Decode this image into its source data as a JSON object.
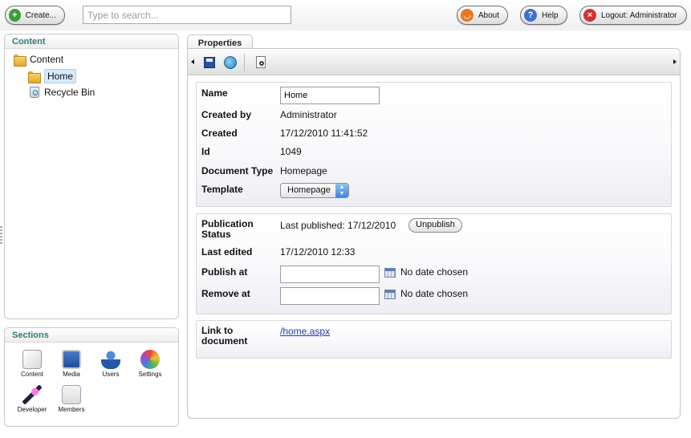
{
  "topbar": {
    "create_label": "Create...",
    "search_placeholder": "Type to search...",
    "about_label": "About",
    "help_label": "Help",
    "logout_label": "Logout: Administrator"
  },
  "content_panel": {
    "title": "Content",
    "tree": {
      "root": "Content",
      "home": "Home",
      "recycle_bin": "Recycle Bin"
    }
  },
  "sections_panel": {
    "title": "Sections",
    "items": [
      "Content",
      "Media",
      "Users",
      "Settings",
      "Developer",
      "Members"
    ]
  },
  "properties": {
    "tab_label": "Properties",
    "name_label": "Name",
    "name_value": "Home",
    "created_by_label": "Created by",
    "created_by_value": "Administrator",
    "created_label": "Created",
    "created_value": "17/12/2010 11:41:52",
    "id_label": "Id",
    "id_value": "1049",
    "doctype_label": "Document Type",
    "doctype_value": "Homepage",
    "template_label": "Template",
    "template_value": "Homepage",
    "publication_status_label": "Publication Status",
    "publication_status_value": "Last published: 17/12/2010",
    "unpublish_label": "Unpublish",
    "last_edited_label": "Last edited",
    "last_edited_value": "17/12/2010 12:33",
    "publish_at_label": "Publish at",
    "publish_at_note": "No date chosen",
    "remove_at_label": "Remove at",
    "remove_at_note": "No date chosen",
    "link_label": "Link to document",
    "link_value": "/home.aspx"
  },
  "colors": {
    "panel_heading": "#2a7e79",
    "link": "#1f3d9c",
    "selected_bg": "#d5ebfb"
  }
}
